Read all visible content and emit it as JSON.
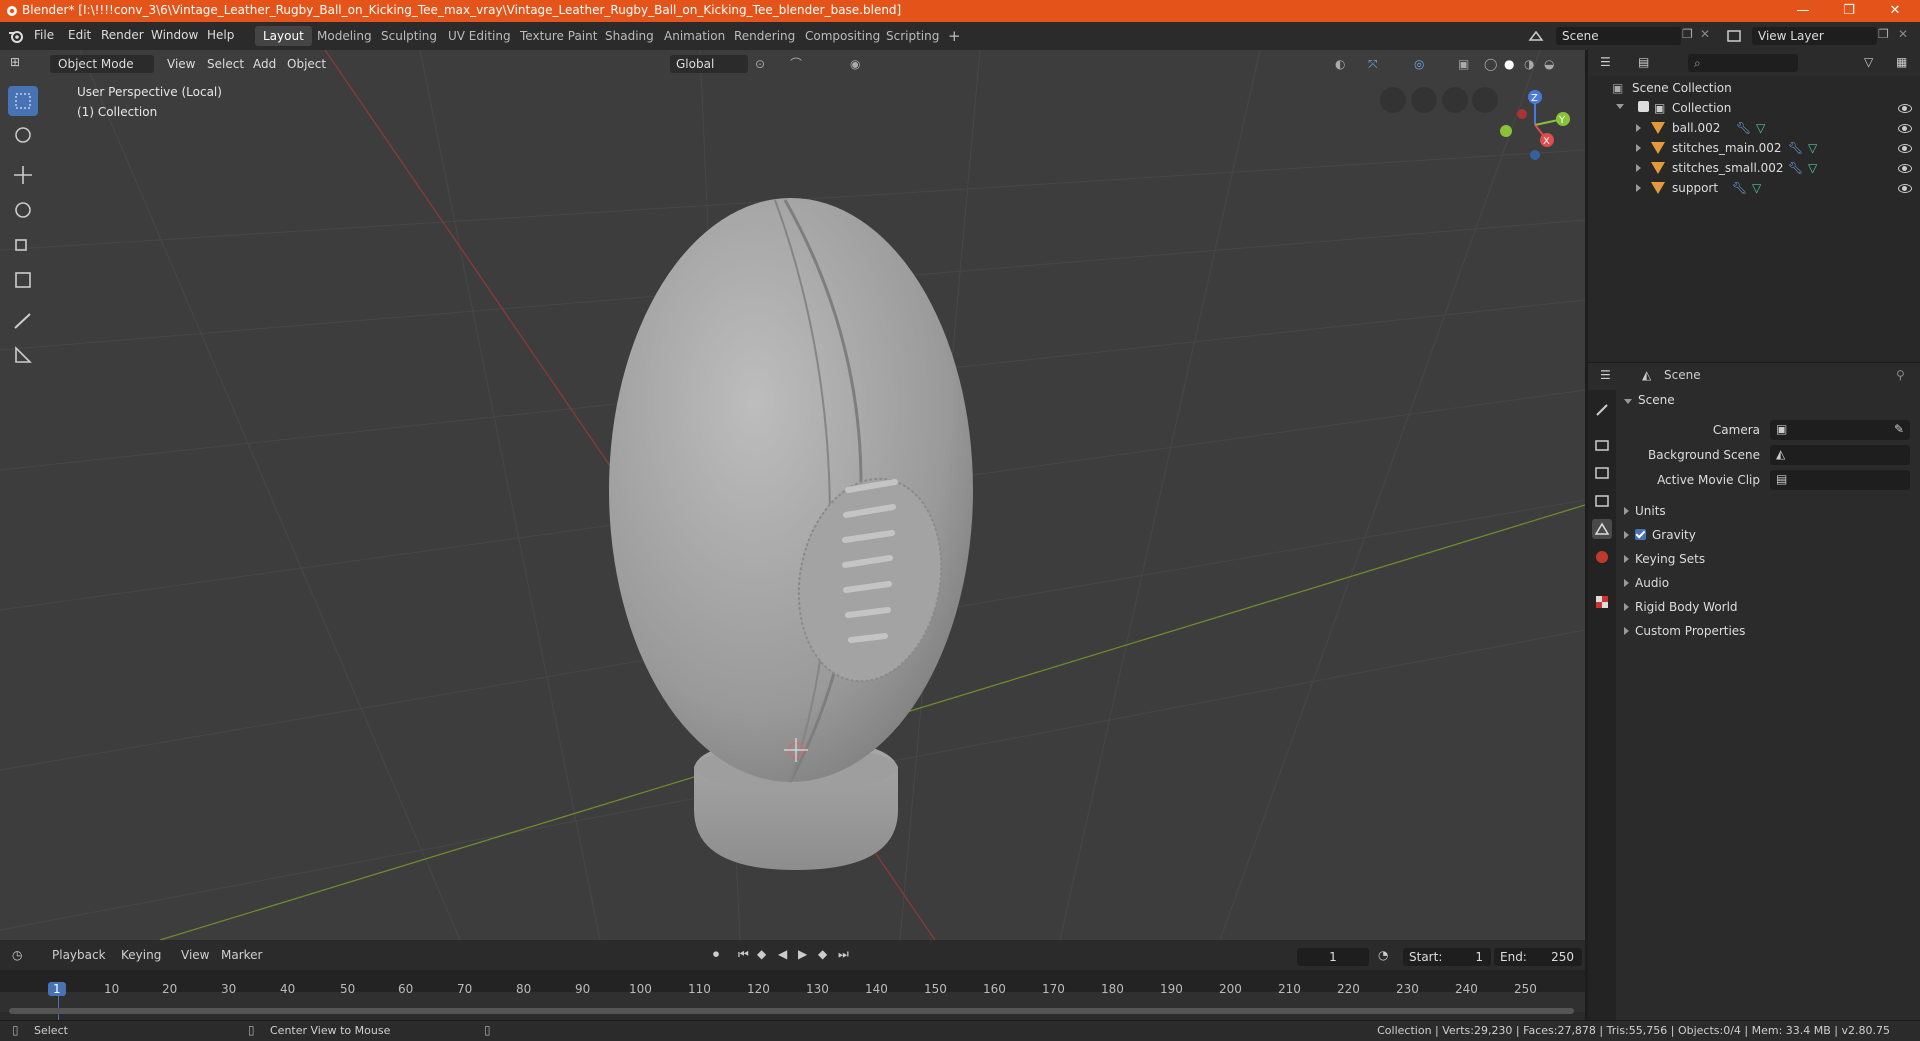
{
  "title_bar": {
    "text": "Blender* [I:\\!!!!conv_3\\6\\Vintage_Leather_Rugby_Ball_on_Kicking_Tee_max_vray\\Vintage_Leather_Rugby_Ball_on_Kicking_Tee_blender_base.blend]",
    "minimize": "—",
    "restore": "❐",
    "close": "✕"
  },
  "menu": [
    "File",
    "Edit",
    "Render",
    "Window",
    "Help"
  ],
  "workspaces": [
    "Layout",
    "Modeling",
    "Sculpting",
    "UV Editing",
    "Texture Paint",
    "Shading",
    "Animation",
    "Rendering",
    "Compositing",
    "Scripting"
  ],
  "add_workspace": "+",
  "scene_field": "Scene",
  "view_layer_field": "View Layer",
  "viewport_header": {
    "mode": "Object Mode",
    "view": "View",
    "select": "Select",
    "add": "Add",
    "object": "Object",
    "transform": "Global"
  },
  "viewport_overlay": {
    "perspective": "User Perspective (Local)",
    "collection": "(1) Collection"
  },
  "gizmo": {
    "z": "Z",
    "y": "Y",
    "x": "X"
  },
  "outliner": {
    "root": "Scene Collection",
    "collection": "Collection",
    "objects": [
      "ball.002",
      "stitches_main.002",
      "stitches_small.002",
      "support"
    ]
  },
  "properties": {
    "header": "Scene",
    "section": "Scene",
    "fields": {
      "camera": "Camera",
      "background_scene": "Background Scene",
      "active_movie_clip": "Active Movie Clip"
    },
    "subsections": [
      "Units",
      "Gravity",
      "Keying Sets",
      "Audio",
      "Rigid Body World",
      "Custom Properties"
    ]
  },
  "timeline": {
    "menus": [
      "Playback",
      "Keying",
      "View",
      "Marker"
    ],
    "current_frame": "1",
    "start_label": "Start:",
    "start": "1",
    "end_label": "End:",
    "end": "250",
    "ruler": [
      "1",
      "10",
      "20",
      "30",
      "40",
      "50",
      "60",
      "70",
      "80",
      "90",
      "100",
      "110",
      "120",
      "130",
      "140",
      "150",
      "160",
      "170",
      "180",
      "190",
      "200",
      "210",
      "220",
      "230",
      "240",
      "250"
    ]
  },
  "status_bar": {
    "left_action": "Select",
    "middle_action": "Center View to Mouse",
    "stats": "Collection | Verts:29,230 | Faces:27,878 | Tris:55,756 | Objects:0/4 | Mem: 33.4 MB | v2.80.75"
  },
  "colors": {
    "accent": "#4772b3",
    "title_bar": "#e4541a",
    "viewport_bg": "#3d3d3d",
    "mesh_icon": "#e49a3a"
  }
}
